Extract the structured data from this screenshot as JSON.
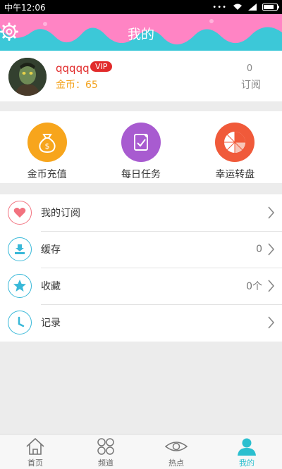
{
  "status_bar": {
    "time": "中午12:06"
  },
  "header": {
    "title": "我的"
  },
  "profile": {
    "username": "qqqqq",
    "vip_badge": "VIP",
    "coins_text": "金币：65",
    "subscriptions_count": "0",
    "subscriptions_label": "订阅"
  },
  "features": [
    {
      "label": "金币充值",
      "icon": "money-bag-icon",
      "color": "#f7a51c"
    },
    {
      "label": "每日任务",
      "icon": "task-check-icon",
      "color": "#a85bd0"
    },
    {
      "label": "幸运转盘",
      "icon": "lucky-wheel-icon",
      "color": "#f05a3a"
    }
  ],
  "menu": [
    {
      "label": "我的订阅",
      "value": "",
      "icon": "heart-icon",
      "color": "#f2727f"
    },
    {
      "label": "缓存",
      "value": "0",
      "icon": "download-icon",
      "color": "#38b8d8"
    },
    {
      "label": "收藏",
      "value": "0个",
      "icon": "star-icon",
      "color": "#38b8d8"
    },
    {
      "label": "记录",
      "value": "",
      "icon": "clock-icon",
      "color": "#38b8d8"
    }
  ],
  "tabs": [
    {
      "label": "首页",
      "icon": "home-icon",
      "active": false
    },
    {
      "label": "频道",
      "icon": "channels-icon",
      "active": false
    },
    {
      "label": "热点",
      "icon": "eye-icon",
      "active": false
    },
    {
      "label": "我的",
      "icon": "user-icon",
      "active": true
    }
  ],
  "colors": {
    "accent": "#2bbfcf",
    "header_pink": "#ff84c4",
    "header_cyan": "#3cc8d8",
    "vip_red": "#e12b2b",
    "coin_gold": "#f3a21b"
  }
}
